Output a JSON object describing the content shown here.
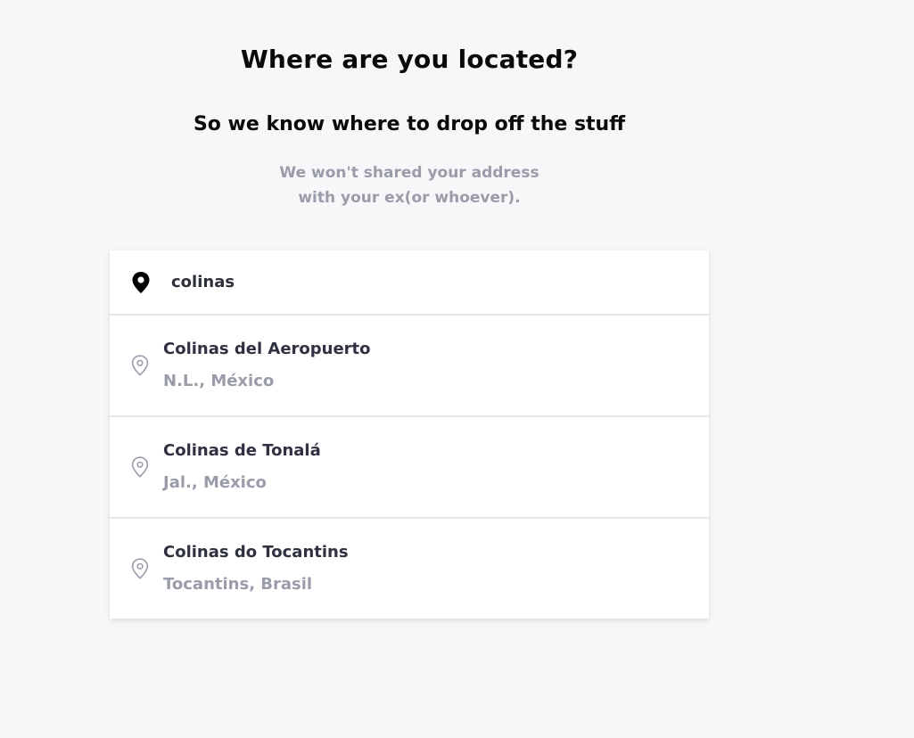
{
  "header": {
    "title": "Where are you located?",
    "subtitle": "So we know where to drop off the stuff",
    "note_line1": "We won't shared your address",
    "note_line2": "with your ex(or whoever)."
  },
  "search": {
    "icon": "map-pin-filled-icon",
    "value": "colinas"
  },
  "results": [
    {
      "name": "Colinas del Aeropuerto",
      "region": "N.L., México",
      "icon": "map-pin-outline-icon"
    },
    {
      "name": "Colinas de Tonalá",
      "region": "Jal., México",
      "icon": "map-pin-outline-icon"
    },
    {
      "name": "Colinas do Tocantins",
      "region": "Tocantins, Brasil",
      "icon": "map-pin-outline-icon"
    }
  ],
  "colors": {
    "background": "#f7f7f9",
    "card": "#ffffff",
    "primary_text": "#0a0a0a",
    "secondary_text": "#9a9caa",
    "divider": "#e4e5ea"
  }
}
